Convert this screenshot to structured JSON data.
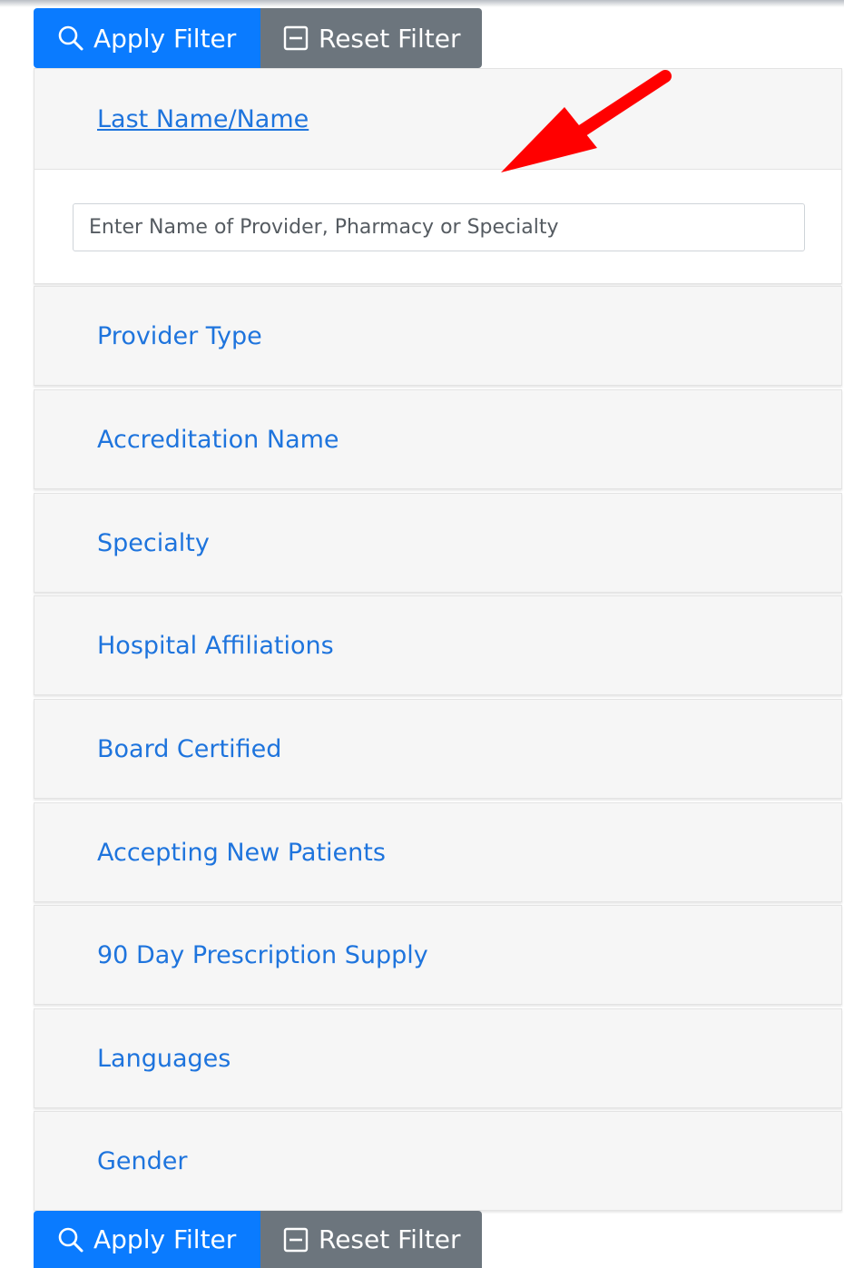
{
  "buttons": {
    "apply_label": "Apply Filter",
    "reset_label": "Reset Filter",
    "apply_color": "#0a7bff",
    "reset_color": "#6c757d"
  },
  "search": {
    "title": "Last Name/Name",
    "placeholder": "Enter Name of Provider, Pharmacy or Specialty",
    "value": ""
  },
  "filters": [
    "Provider Type",
    "Accreditation Name",
    "Specialty",
    "Hospital Affiliations",
    "Board Certified",
    "Accepting New Patients",
    "90 Day Prescription Supply",
    "Languages",
    "Gender"
  ],
  "annotation": {
    "arrow_color": "#ff0000"
  }
}
